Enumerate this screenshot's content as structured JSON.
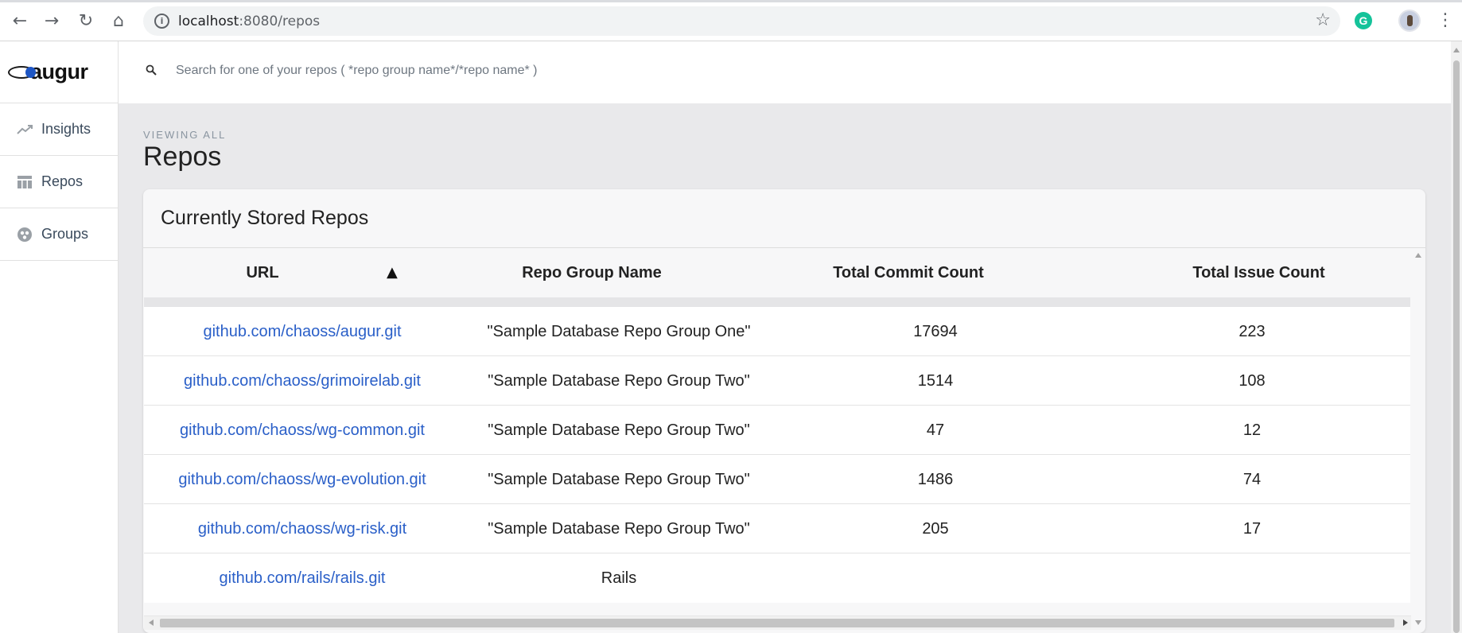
{
  "browser": {
    "url_host": "localhost",
    "url_path": ":8080/repos",
    "back_icon": "←",
    "forward_icon": "→",
    "reload_icon": "↻",
    "home_icon": "⌂",
    "star_icon": "☆",
    "extension_letter": "G",
    "menu_icon": "⋮"
  },
  "sidebar": {
    "logo_text": "augur",
    "items": [
      {
        "label": "Insights",
        "icon": "trending-up-icon"
      },
      {
        "label": "Repos",
        "icon": "table-icon"
      },
      {
        "label": "Groups",
        "icon": "groups-icon"
      }
    ]
  },
  "search": {
    "placeholder": "Search for one of your repos ( *repo group name*/*repo name* )"
  },
  "page": {
    "subtitle": "VIEWING ALL",
    "title": "Repos"
  },
  "card": {
    "title": "Currently Stored Repos"
  },
  "table": {
    "sort_indicator": "▲",
    "columns": [
      "URL",
      "Repo Group Name",
      "Total Commit Count",
      "Total Issue Count"
    ],
    "rows": [
      {
        "url": "github.com/chaoss/augur.git",
        "group": "\"Sample Database Repo Group One\"",
        "commits": "17694",
        "issues": "223"
      },
      {
        "url": "github.com/chaoss/grimoirelab.git",
        "group": "\"Sample Database Repo Group Two\"",
        "commits": "1514",
        "issues": "108"
      },
      {
        "url": "github.com/chaoss/wg-common.git",
        "group": "\"Sample Database Repo Group Two\"",
        "commits": "47",
        "issues": "12"
      },
      {
        "url": "github.com/chaoss/wg-evolution.git",
        "group": "\"Sample Database Repo Group Two\"",
        "commits": "1486",
        "issues": "74"
      },
      {
        "url": "github.com/chaoss/wg-risk.git",
        "group": "\"Sample Database Repo Group Two\"",
        "commits": "205",
        "issues": "17"
      },
      {
        "url": "github.com/rails/rails.git",
        "group": "Rails",
        "commits": "",
        "issues": ""
      }
    ]
  },
  "colors": {
    "link": "#2a5fc8",
    "sidebar_text": "#3a4a5c",
    "background": "#e9e9eb"
  }
}
